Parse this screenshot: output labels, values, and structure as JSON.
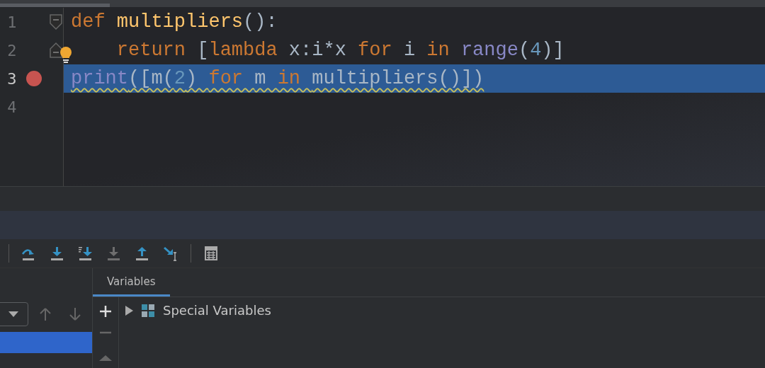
{
  "editor": {
    "lines": [
      {
        "number": "1",
        "fold_open": true,
        "tokens": [
          {
            "kind": "kw",
            "text": "def "
          },
          {
            "kind": "fn",
            "text": "multipliers"
          },
          {
            "kind": "plain",
            "text": "():"
          }
        ]
      },
      {
        "number": "2",
        "fold_close": true,
        "bulb": true,
        "tokens": [
          {
            "kind": "kw",
            "text": "    return "
          },
          {
            "kind": "plain",
            "text": "["
          },
          {
            "kind": "kw",
            "text": "lambda "
          },
          {
            "kind": "plain",
            "text": "x:i*x "
          },
          {
            "kind": "kw",
            "text": "for "
          },
          {
            "kind": "plain",
            "text": "i "
          },
          {
            "kind": "kw",
            "text": "in "
          },
          {
            "kind": "builtin",
            "text": "range"
          },
          {
            "kind": "plain",
            "text": "("
          },
          {
            "kind": "num",
            "text": "4"
          },
          {
            "kind": "plain",
            "text": ")]"
          }
        ]
      },
      {
        "number": "3",
        "breakpoint": true,
        "current": true,
        "squiggle": true,
        "tokens": [
          {
            "kind": "builtin",
            "text": "print"
          },
          {
            "kind": "plain",
            "text": "([m("
          },
          {
            "kind": "num",
            "text": "2"
          },
          {
            "kind": "plain",
            "text": ") "
          },
          {
            "kind": "kw",
            "text": "for "
          },
          {
            "kind": "plain",
            "text": "m "
          },
          {
            "kind": "kw",
            "text": "in "
          },
          {
            "kind": "plain",
            "text": "multipliers()])"
          }
        ]
      },
      {
        "number": "4"
      }
    ]
  },
  "debug_toolbar": [
    {
      "kind": "step-over"
    },
    {
      "kind": "step-into"
    },
    {
      "kind": "step-into-my-code"
    },
    {
      "kind": "force-step-into",
      "disabled": true
    },
    {
      "kind": "step-out"
    },
    {
      "kind": "run-to-cursor"
    },
    {
      "kind": "separator"
    },
    {
      "kind": "evaluate"
    }
  ],
  "frames": {
    "rows": [
      {
        "selected": true
      }
    ]
  },
  "variables": {
    "tab": {
      "label": "Variables",
      "selected": true
    },
    "items": [
      {
        "label": "Special Variables",
        "expanded": false
      }
    ]
  }
}
